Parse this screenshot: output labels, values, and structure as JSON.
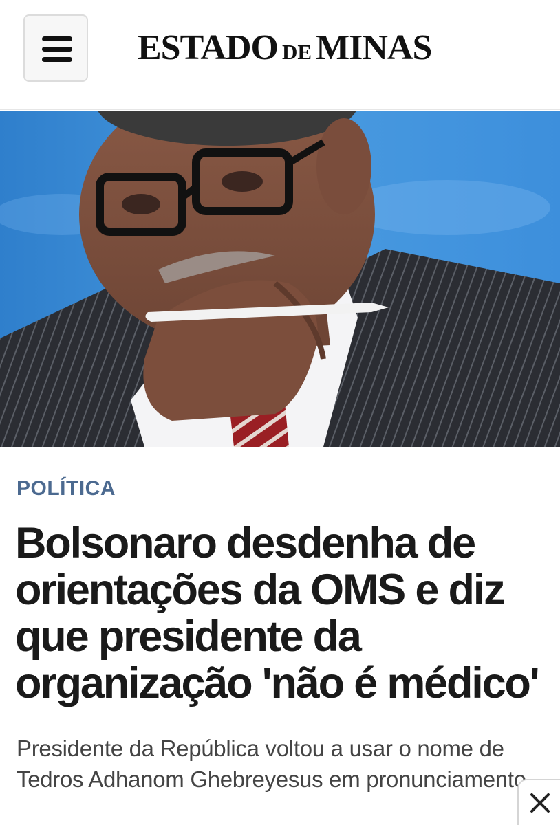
{
  "header": {
    "logo_big1": "ESTADO",
    "logo_small": "DE",
    "logo_big2": "MINAS",
    "menu_icon": "hamburger-icon"
  },
  "hero": {
    "colors": {
      "background": "#3c8ed9"
    }
  },
  "article": {
    "section": "POLÍTICA",
    "headline": "Bolsonaro desdenha de orientações da OMS e diz que presidente da organização 'não é médico'",
    "subtitle": "Presidente da República voltou a usar o nome de Tedros Adhanom Ghebreyesus em pronunciamento"
  },
  "overlay": {
    "close_icon": "close-icon"
  },
  "colors": {
    "section": "#4c6a90",
    "headline": "#1a1a1a",
    "subtitle": "#444444"
  }
}
